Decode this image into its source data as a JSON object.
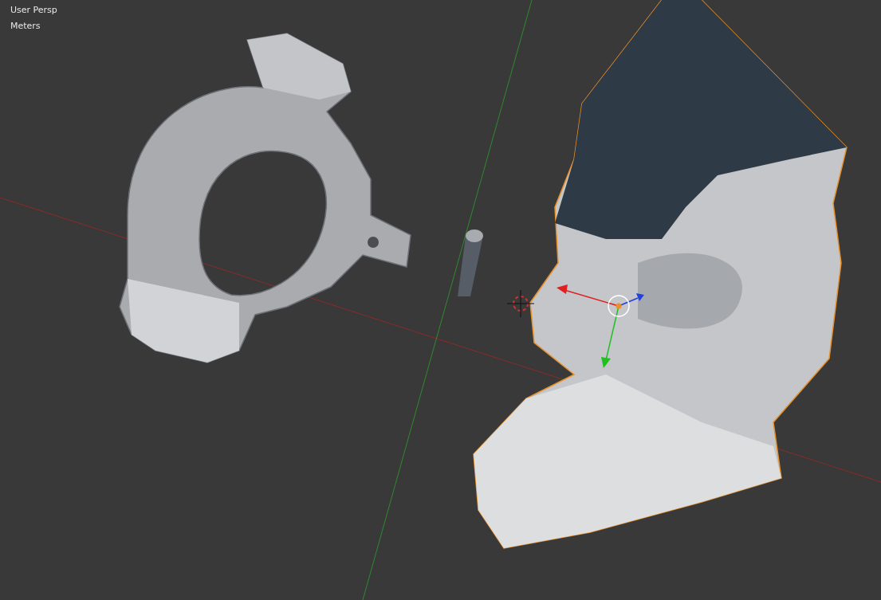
{
  "viewport": {
    "view_label": "User Persp",
    "units_label": "Meters"
  }
}
